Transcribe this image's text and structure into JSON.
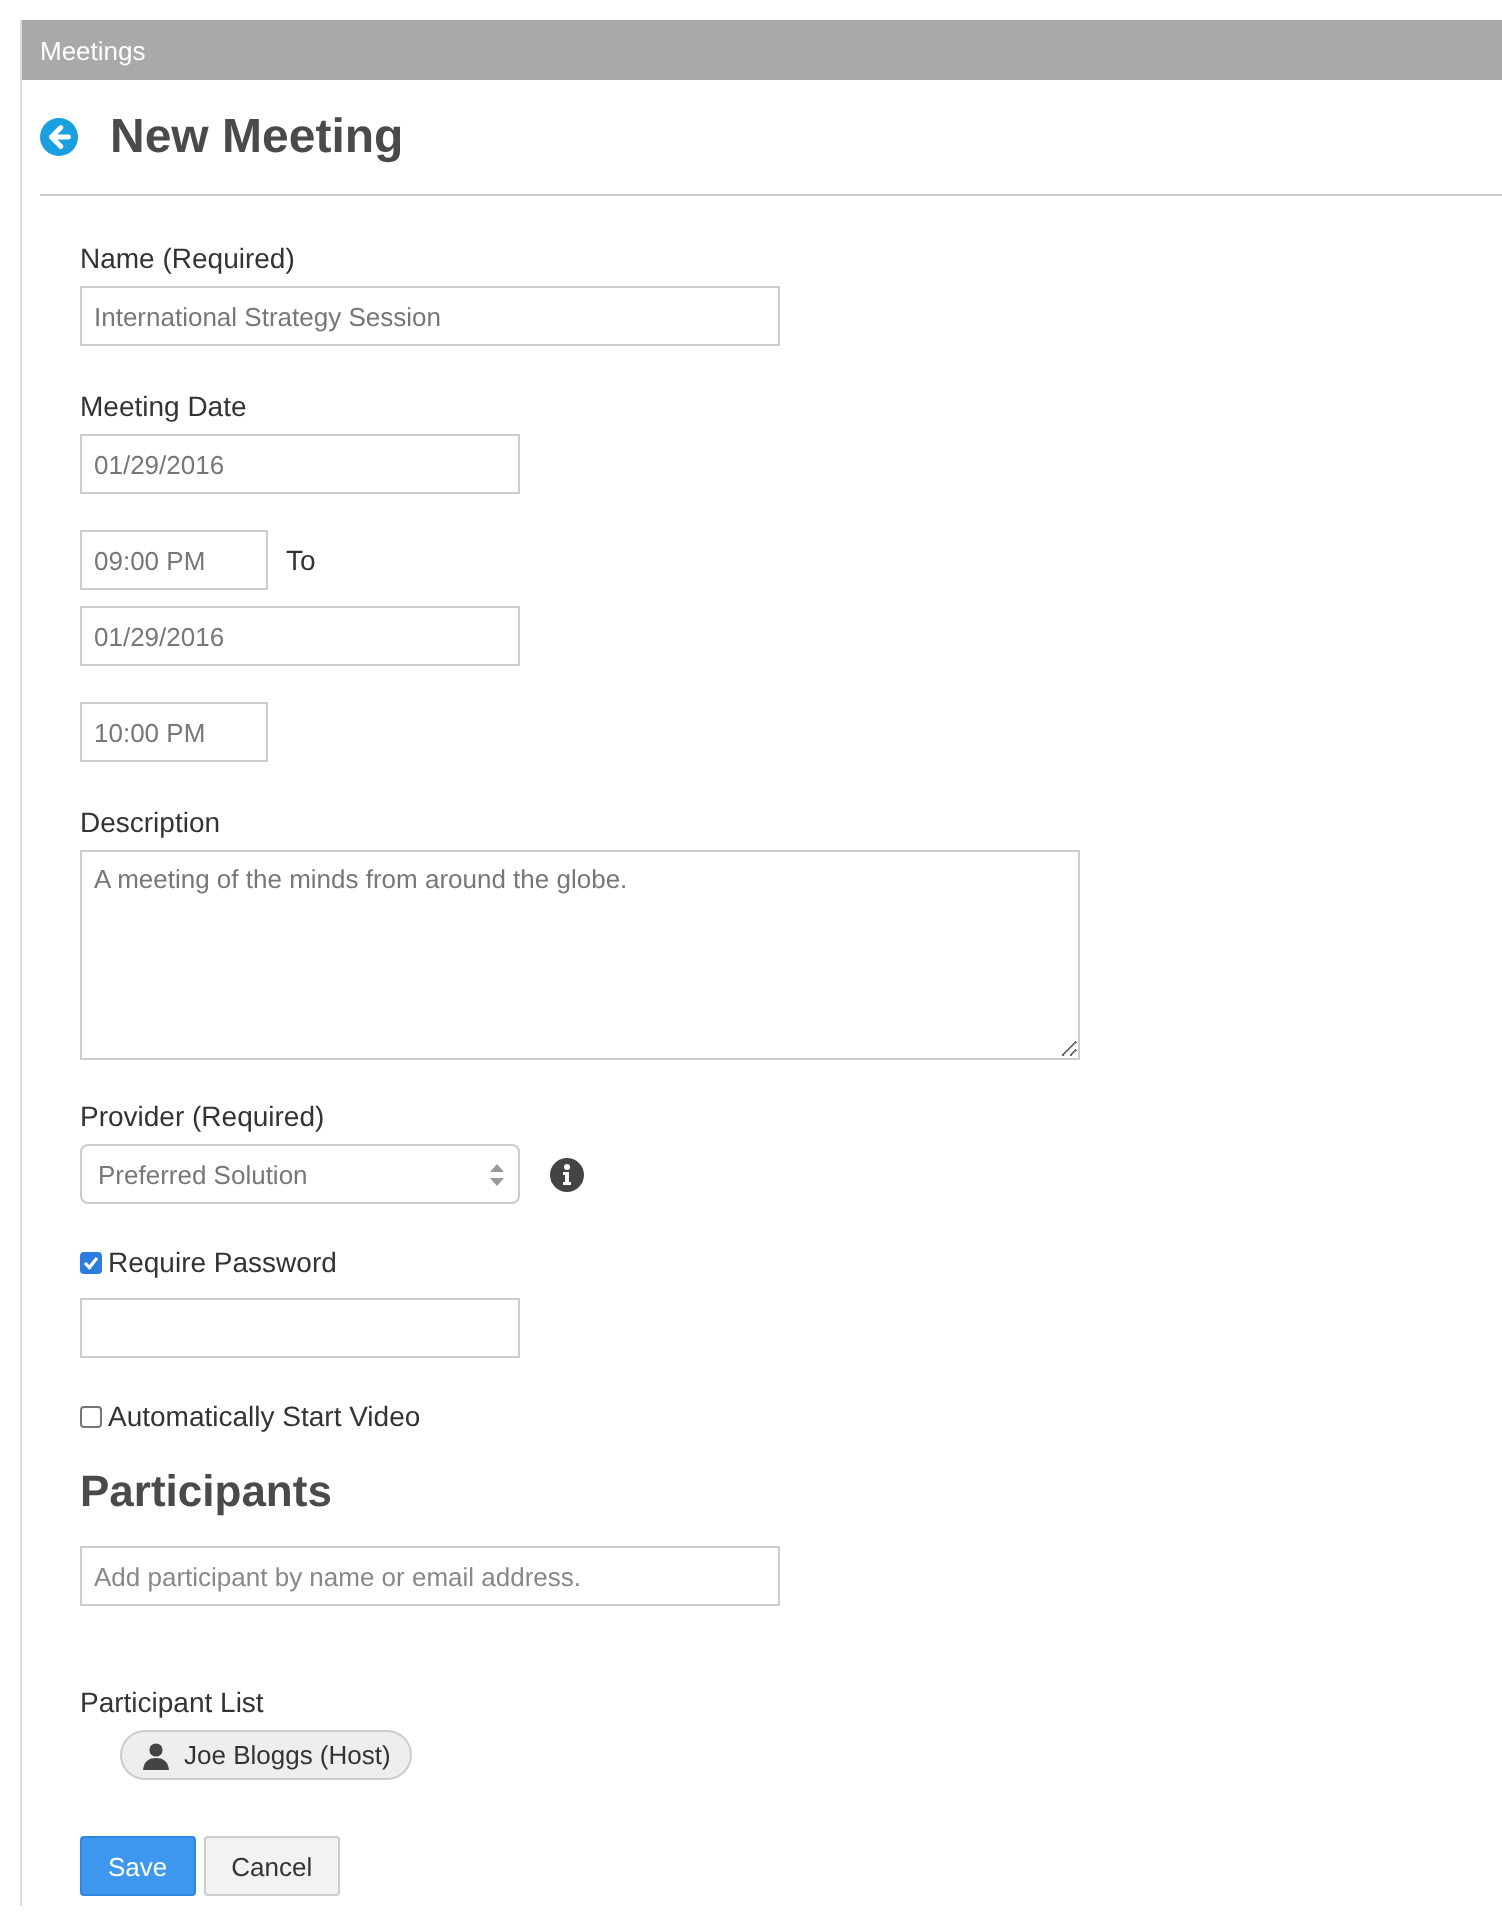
{
  "panel": {
    "title": "Meetings"
  },
  "page_title": "New Meeting",
  "name_field": {
    "label": "Name (Required)",
    "value": "International Strategy Session"
  },
  "meeting_date": {
    "label": "Meeting Date",
    "start_date": "01/29/2016",
    "start_time": "09:00 PM",
    "separator": "To",
    "end_date": "01/29/2016",
    "end_time": "10:00 PM"
  },
  "description": {
    "label": "Description",
    "value": "A meeting of the minds from around the globe."
  },
  "provider": {
    "label": "Provider (Required)",
    "value": "Preferred Solution"
  },
  "options": [
    {
      "label": "Require Password",
      "checked": true,
      "password_field": true
    },
    {
      "label": "Automatically Start Video",
      "checked": false,
      "password_field": false
    }
  ],
  "participants": {
    "heading": "Participants",
    "placeholder": "Add participant by name or email address.",
    "list_label": "Participant List",
    "list": [
      {
        "name": "Joe Bloggs (Host)"
      }
    ]
  },
  "buttons": [
    {
      "label": "Save",
      "kind": "primary"
    },
    {
      "label": "Cancel",
      "kind": "default"
    }
  ]
}
